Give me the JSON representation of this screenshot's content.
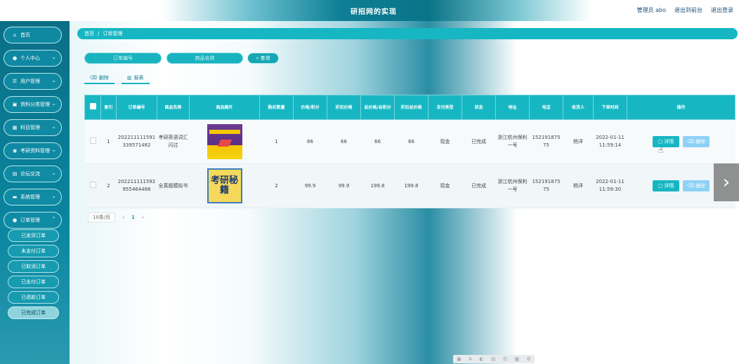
{
  "header": {
    "title": "研招网的实现",
    "links": [
      "管理员 abo",
      "退出到前台",
      "退出登录"
    ]
  },
  "sidebar": {
    "items": [
      {
        "label": "首页",
        "icon": "home-icon",
        "glyph": "⌂"
      },
      {
        "label": "个人中心",
        "icon": "user-icon",
        "glyph": "●"
      },
      {
        "label": "用户管理",
        "icon": "list-icon",
        "glyph": "☰"
      },
      {
        "label": "资料分类管理",
        "icon": "folder-icon",
        "glyph": "▣"
      },
      {
        "label": "科目管理",
        "icon": "grid-icon",
        "glyph": "▦"
      },
      {
        "label": "考研资料管理",
        "icon": "book-icon",
        "glyph": "◉"
      },
      {
        "label": "论坛交流",
        "icon": "chat-icon",
        "glyph": "▤"
      },
      {
        "label": "系统管理",
        "icon": "settings-icon",
        "glyph": "▬"
      },
      {
        "label": "订单管理",
        "icon": "order-icon",
        "glyph": "●"
      }
    ],
    "sub_items": [
      "已发货订单",
      "未支付订单",
      "已取消订单",
      "已支付订单",
      "已退款订单",
      "已完成订单"
    ],
    "active_sub": "已完成订单"
  },
  "breadcrumb": {
    "home": "首页",
    "separator": "/",
    "current": "订单管理"
  },
  "search": {
    "order_no_placeholder": "订单编号",
    "product_name_placeholder": "商品名称",
    "search_label": "查询",
    "search_icon": "search-icon"
  },
  "actions": {
    "delete_label": "删除",
    "report_label": "报表"
  },
  "table": {
    "headers": [
      "索引",
      "订单编号",
      "商品名称",
      "商品图片",
      "购买数量",
      "价格/积分",
      "折扣价格",
      "总价格/总积分",
      "折扣总价格",
      "支付类型",
      "状态",
      "地址",
      "电话",
      "收货人",
      "下单时间",
      "操作"
    ],
    "rows": [
      {
        "index": "1",
        "order_no": "202211111591339571482",
        "product_name": "考研英语词汇闪过",
        "image_text": "",
        "quantity": "1",
        "price": "66",
        "discount_price": "66",
        "total": "66",
        "discount_total": "66",
        "pay_type": "现金",
        "status": "已完成",
        "address": "浙江杭州保利一号",
        "phone": "15219187575",
        "receiver": "杨洋",
        "order_time": "2022-01-11 11:59:14"
      },
      {
        "index": "2",
        "order_no": "202211111592955464486",
        "product_name": "全真题模拟书",
        "image_text": "考研秘籍",
        "quantity": "2",
        "price": "99.9",
        "discount_price": "99.9",
        "total": "199.8",
        "discount_total": "199.8",
        "pay_type": "现金",
        "status": "已完成",
        "address": "浙江杭州保利一号",
        "phone": "15219187575",
        "receiver": "杨洋",
        "order_time": "2022-01-11 11:59:30"
      }
    ],
    "detail_label": "详情",
    "delete_label": "删除"
  },
  "pagination": {
    "page_size": "10条/页",
    "prev": "‹",
    "current": "1",
    "next": "›"
  },
  "colors": {
    "accent": "#16b7c3",
    "sidebar": "#0a86a0",
    "delete": "#8ed1f6"
  }
}
